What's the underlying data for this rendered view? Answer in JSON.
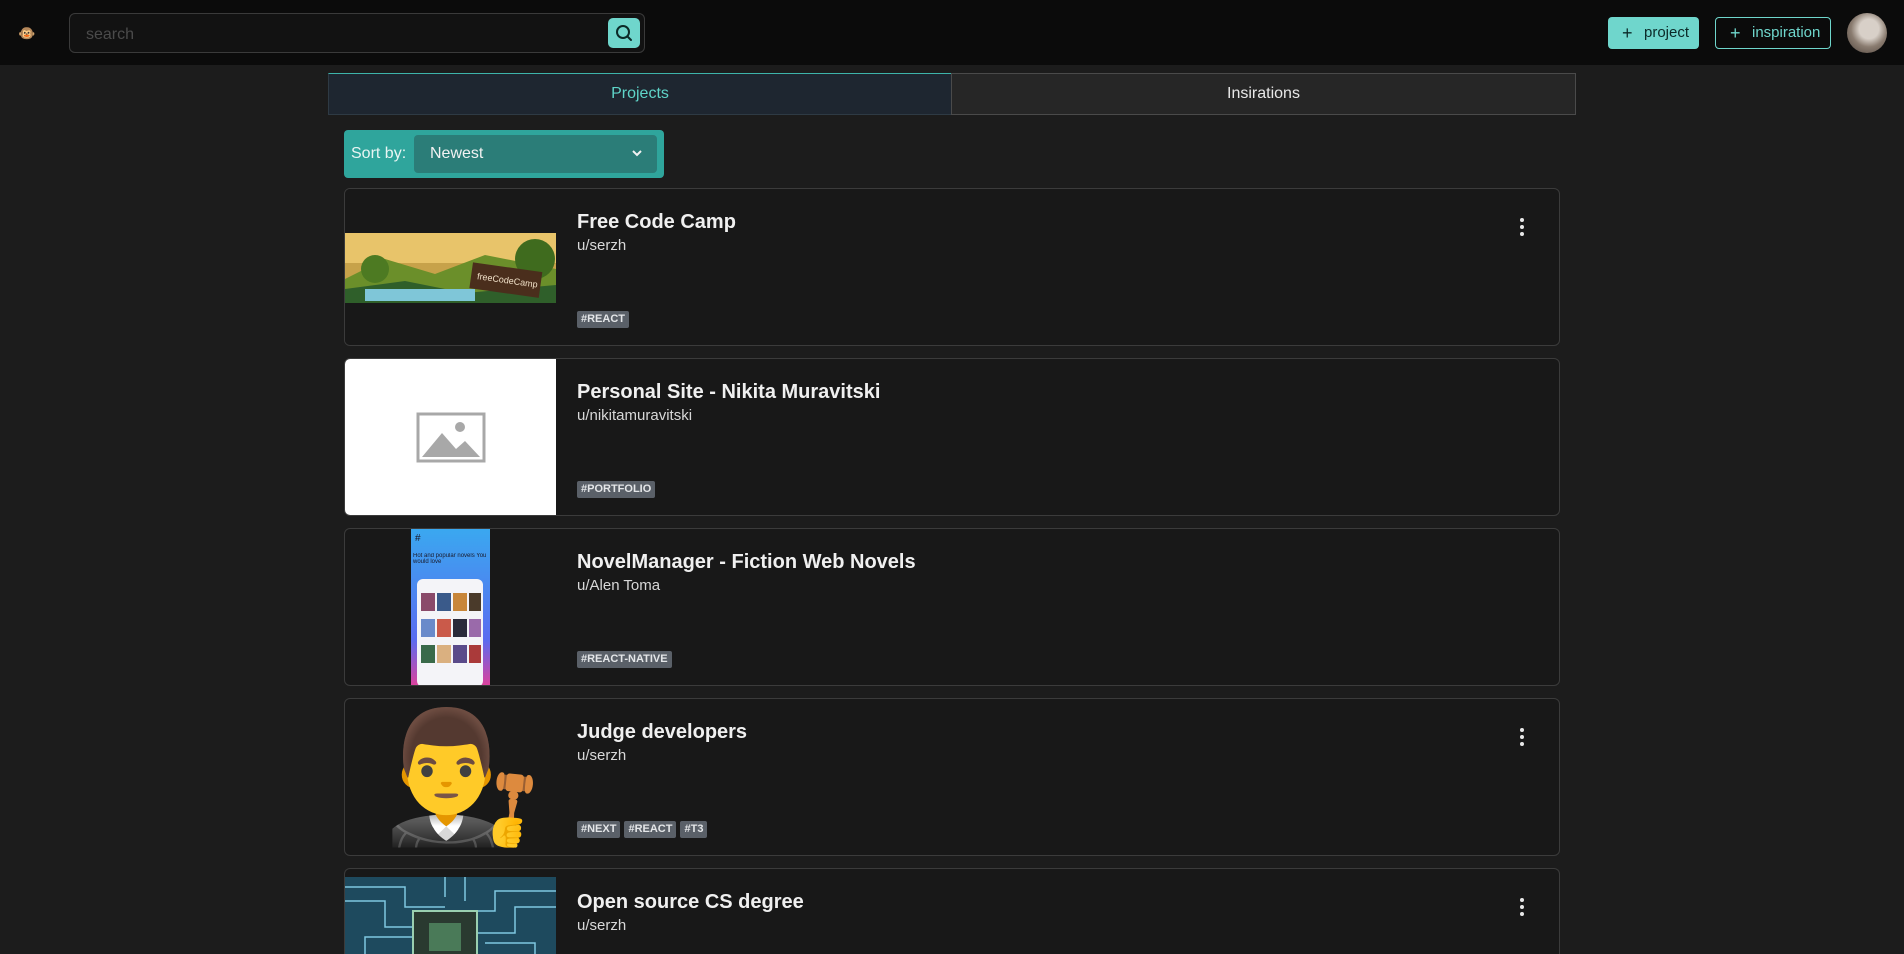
{
  "header": {
    "search_placeholder": "search",
    "project_button": "project",
    "inspiration_button": "inspiration"
  },
  "tabs": [
    {
      "label": "Projects",
      "active": true
    },
    {
      "label": "Insirations",
      "active": false
    }
  ],
  "sort": {
    "label": "Sort by:",
    "value": "Newest"
  },
  "colors": {
    "accent": "#6fd6cc",
    "background": "#1c1c1c",
    "tag": "#5a6068"
  },
  "projects": [
    {
      "title": "Free Code Camp",
      "author": "u/serzh",
      "tags": [
        "#REACT"
      ],
      "thumb_text": "freeCodeCamp",
      "has_menu": true
    },
    {
      "title": "Personal Site - Nikita Muravitski",
      "author": "u/nikitamuravitski",
      "tags": [
        "#PORTFOLIO"
      ],
      "has_menu": false
    },
    {
      "title": "NovelManager - Fiction Web Novels",
      "author": "u/Alen Toma",
      "tags": [
        "#REACT-NATIVE"
      ],
      "thumb_text": "Hot and popular novels You would love",
      "has_menu": false
    },
    {
      "title": "Judge developers",
      "author": "u/serzh",
      "tags": [
        "#NEXT",
        "#REACT",
        "#T3"
      ],
      "thumb_emoji": "👨‍⚖️",
      "has_menu": true
    },
    {
      "title": "Open source CS degree",
      "author": "u/serzh",
      "tags": [],
      "has_menu": true
    }
  ]
}
